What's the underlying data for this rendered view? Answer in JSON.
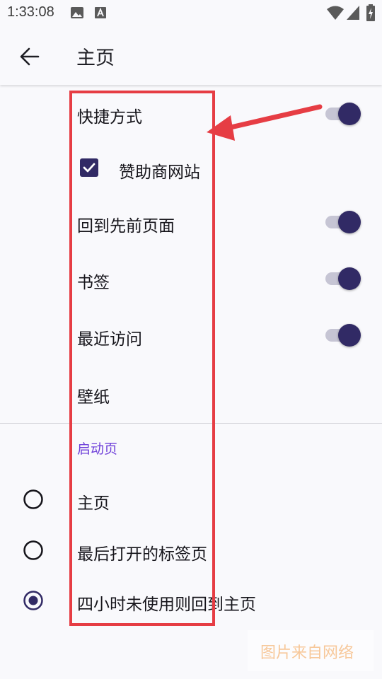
{
  "status_bar": {
    "time": "1:33:08",
    "left_icons": [
      "image-icon",
      "a-box-icon"
    ],
    "right_icons": [
      "wifi-icon",
      "signal-icon",
      "battery-charging-icon"
    ]
  },
  "app_bar": {
    "back_icon": "arrow-left-icon",
    "title": "主页"
  },
  "settings": {
    "shortcuts": {
      "label": "快捷方式",
      "enabled": true
    },
    "sponsored": {
      "label": "赞助商网站",
      "checked": true
    },
    "jump_back_in": {
      "label": "回到先前页面",
      "enabled": true
    },
    "bookmarks": {
      "label": "书签",
      "enabled": true
    },
    "recent": {
      "label": "最近访问",
      "enabled": true
    },
    "wallpaper": {
      "label": "壁纸"
    }
  },
  "opening_screen": {
    "header": "启动页",
    "options": [
      {
        "label": "主页",
        "selected": false
      },
      {
        "label": "最后打开的标签页",
        "selected": false
      },
      {
        "label": "四小时未使用则回到主页",
        "selected": true
      }
    ]
  },
  "watermark": "图片来自网络",
  "colors": {
    "accent": "#312a65",
    "switch_track": "#c6c5d4",
    "section_header": "#6e3fd9",
    "annotation_red": "#e63d44",
    "background": "#f9f9fc"
  }
}
